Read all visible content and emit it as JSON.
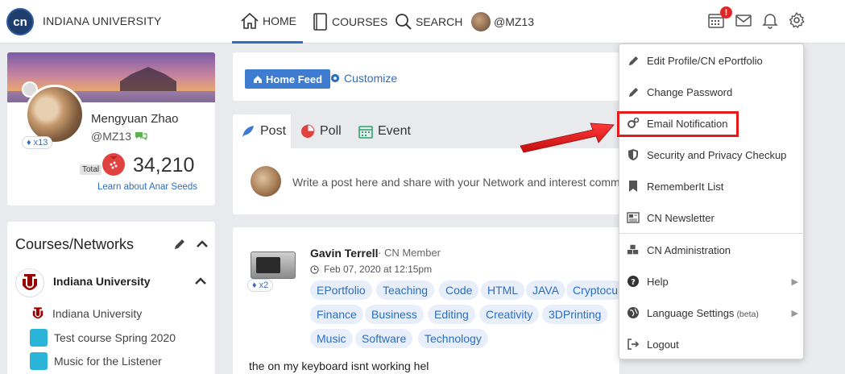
{
  "header": {
    "logo_text": "cn",
    "org_name": "INDIANA UNIVERSITY",
    "nav": {
      "home": "HOME",
      "courses": "COURSES",
      "search": "SEARCH",
      "user": "@MZ13"
    },
    "notification_badge": "!"
  },
  "profile": {
    "name": "Mengyuan Zhao",
    "handle": "@MZ13",
    "badge_count": "x13",
    "total_label": "Total",
    "points": "34,210",
    "learn_link": "Learn about Anar Seeds"
  },
  "courses": {
    "title": "Courses/Networks",
    "network_name": "Indiana University",
    "items": [
      {
        "label": "Indiana University"
      },
      {
        "label": "Test course Spring 2020"
      },
      {
        "label": "Music for the Listener"
      }
    ]
  },
  "feed": {
    "home_feed_label": "Home Feed",
    "customize_label": "Customize"
  },
  "composer": {
    "tabs": [
      {
        "label": "Post"
      },
      {
        "label": "Poll"
      },
      {
        "label": "Event"
      }
    ],
    "placeholder": "Write a post here and share with your Network and interest comm"
  },
  "post": {
    "author": "Gavin Terrell",
    "role": "· CN Member",
    "date": "Feb 07, 2020 at 12:15pm",
    "badge_count": "x2",
    "tags": [
      "EPortfolio",
      "Teaching",
      "Code",
      "HTML",
      "JAVA",
      "Cryptocu",
      "Finance",
      "Business",
      "Editing",
      "Creativity",
      "3DPrinting",
      "Music",
      "Software",
      "Technology"
    ],
    "body": "the on my keyboard isnt working hel"
  },
  "dropdown": {
    "items": [
      {
        "label": "Edit Profile/CN ePortfolio",
        "icon": "pencil-icon"
      },
      {
        "label": "Change Password",
        "icon": "pencil-icon"
      },
      {
        "label": "Email Notification",
        "icon": "gears-icon"
      },
      {
        "label": "Security and Privacy Checkup",
        "icon": "shield-icon"
      },
      {
        "label": "RememberIt List",
        "icon": "bookmark-icon"
      },
      {
        "label": "CN Newsletter",
        "icon": "newspaper-icon"
      },
      {
        "label": "CN Administration",
        "icon": "cubes-icon"
      },
      {
        "label": "Help",
        "icon": "question-circle-icon"
      },
      {
        "label": "Language Settings",
        "icon": "globe-icon",
        "suffix": "(beta)"
      },
      {
        "label": "Logout",
        "icon": "logout-icon"
      }
    ]
  },
  "colors": {
    "accent": "#2d6ec0",
    "highlight": "#e51a1a",
    "tag_bg": "#e8eefa"
  }
}
